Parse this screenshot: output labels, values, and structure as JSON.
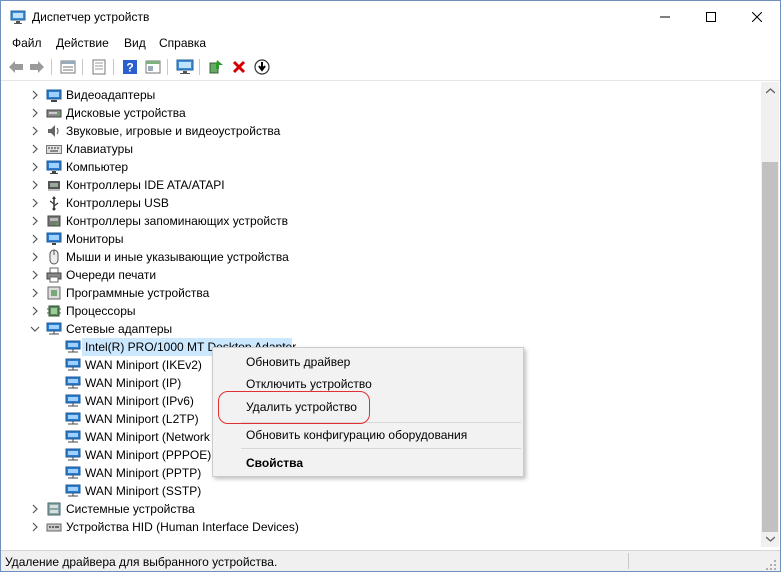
{
  "window": {
    "title": "Диспетчер устройств",
    "controls": {
      "minimize": "—",
      "maximize": "☐",
      "close": "✕"
    }
  },
  "menu": {
    "items": [
      "Файл",
      "Действие",
      "Вид",
      "Справка"
    ]
  },
  "toolbar": {
    "buttons": [
      "back-icon",
      "forward-icon",
      "properties-icon",
      "show-hidden-icon",
      "help-icon",
      "computer-view-icon",
      "monitor-icon",
      "update-driver-icon",
      "delete-icon",
      "download-icon"
    ]
  },
  "tree": {
    "categories": [
      {
        "label": "Видеоадаптеры",
        "icon": "display-adapter-icon",
        "expanded": false
      },
      {
        "label": "Дисковые устройства",
        "icon": "disk-drive-icon",
        "expanded": false
      },
      {
        "label": "Звуковые, игровые и видеоустройства",
        "icon": "sound-icon",
        "expanded": false
      },
      {
        "label": "Клавиатуры",
        "icon": "keyboard-icon",
        "expanded": false
      },
      {
        "label": "Компьютер",
        "icon": "computer-icon",
        "expanded": false
      },
      {
        "label": "Контроллеры IDE ATA/ATAPI",
        "icon": "ide-controller-icon",
        "expanded": false
      },
      {
        "label": "Контроллеры USB",
        "icon": "usb-icon",
        "expanded": false
      },
      {
        "label": "Контроллеры запоминающих устройств",
        "icon": "storage-controller-icon",
        "expanded": false
      },
      {
        "label": "Мониторы",
        "icon": "monitor-icon",
        "expanded": false
      },
      {
        "label": "Мыши и иные указывающие устройства",
        "icon": "mouse-icon",
        "expanded": false
      },
      {
        "label": "Очереди печати",
        "icon": "printer-icon",
        "expanded": false
      },
      {
        "label": "Программные устройства",
        "icon": "software-device-icon",
        "expanded": false
      },
      {
        "label": "Процессоры",
        "icon": "processor-icon",
        "expanded": false
      },
      {
        "label": "Сетевые адаптеры",
        "icon": "network-adapter-icon",
        "expanded": true
      }
    ],
    "network_children": [
      "Intel(R) PRO/1000 MT Desktop Adapter",
      "WAN Miniport (IKEv2)",
      "WAN Miniport (IP)",
      "WAN Miniport (IPv6)",
      "WAN Miniport (L2TP)",
      "WAN Miniport (Network Monitor)",
      "WAN Miniport (PPPOE)",
      "WAN Miniport (PPTP)",
      "WAN Miniport (SSTP)"
    ],
    "after": [
      {
        "label": "Системные устройства",
        "icon": "system-device-icon"
      },
      {
        "label": "Устройства HID (Human Interface Devices)",
        "icon": "hid-icon"
      }
    ]
  },
  "context_menu": {
    "items": [
      "Обновить драйвер",
      "Отключить устройство",
      "Удалить устройство",
      "Обновить конфигурацию оборудования",
      "Свойства"
    ]
  },
  "status": {
    "text": "Удаление драйвера для выбранного устройства."
  },
  "colors": {
    "selection": "#cce8ff",
    "highlight_ring": "#e03030",
    "delete_red": "#d40000",
    "help_blue": "#2b5fd0"
  }
}
